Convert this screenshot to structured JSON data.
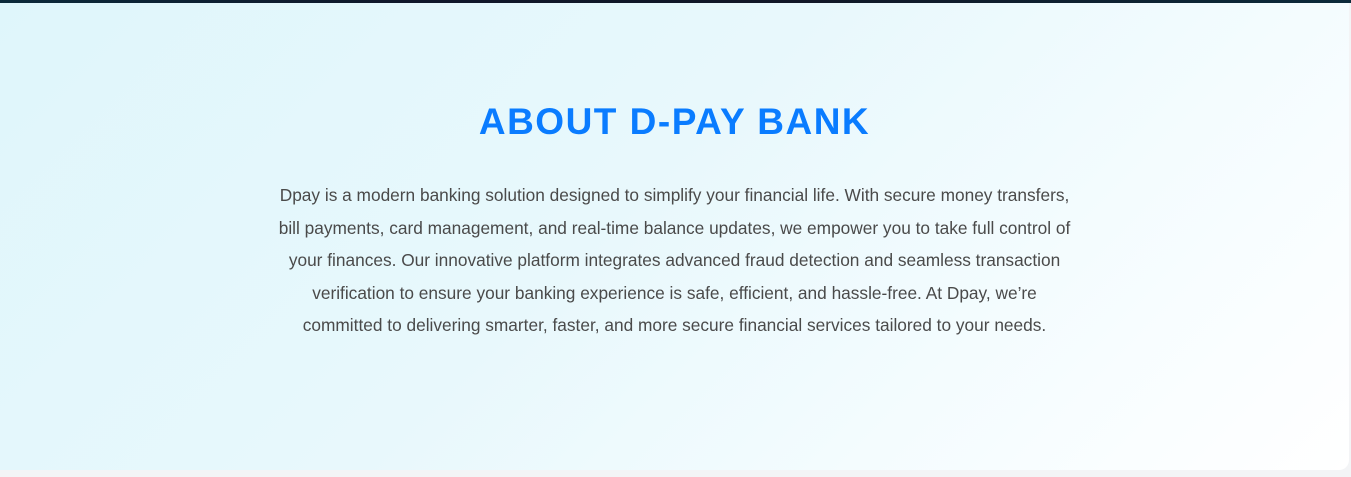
{
  "about": {
    "title": "ABOUT D-PAY BANK",
    "description": "Dpay is a modern banking solution designed to simplify your financial life. With secure money transfers, bill payments, card management, and real-time balance updates, we empower you to take full control of your finances. Our innovative platform integrates advanced fraud detection and seamless transaction verification to ensure your banking experience is safe, efficient, and hassle-free. At Dpay, we’re committed to delivering smarter, faster, and more secure financial services tailored to your needs."
  },
  "colors": {
    "title": "#0a7cff",
    "body_text": "#4a4a4a",
    "background_start": "#dff6fb",
    "background_end": "#ffffff"
  }
}
